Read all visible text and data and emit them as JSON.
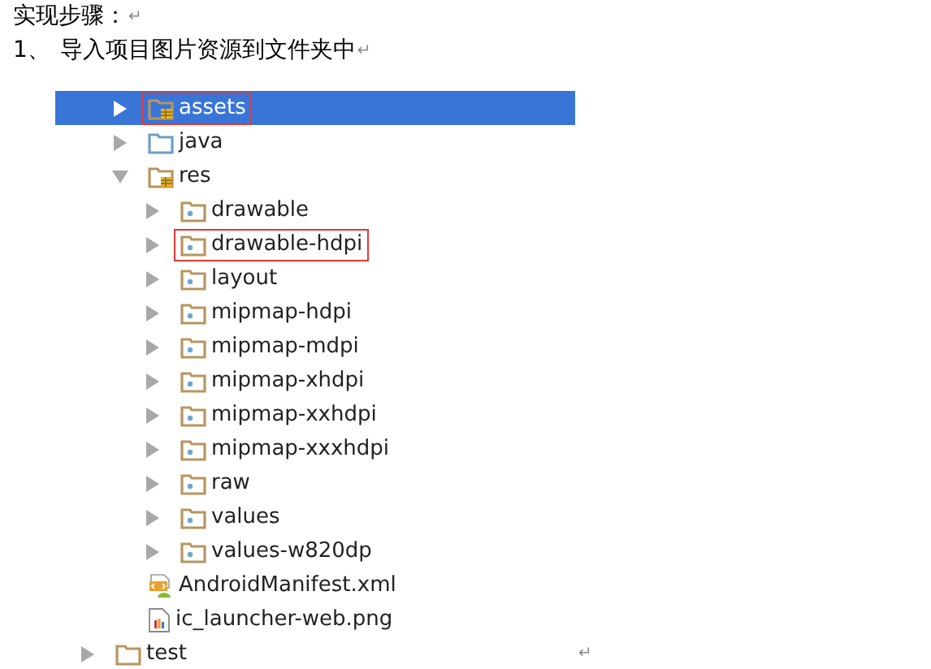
{
  "lines": [
    {
      "text": "实现步骤：",
      "end_mark": "↵"
    },
    {
      "number": "1、",
      "text": "导入项目图片资源到文件夹中",
      "end_mark": "↵"
    }
  ],
  "tree": {
    "items": [
      {
        "label": "assets",
        "kind": "assets-folder",
        "expanded": false,
        "selected": true,
        "marked": true
      },
      {
        "label": "java",
        "kind": "source-folder",
        "expanded": false,
        "selected": false,
        "marked": false
      },
      {
        "label": "res",
        "kind": "res-folder",
        "expanded": true,
        "selected": false,
        "marked": false,
        "children": [
          {
            "label": "drawable",
            "kind": "folder",
            "expanded": false,
            "selected": false,
            "marked": false
          },
          {
            "label": "drawable-hdpi",
            "kind": "folder",
            "expanded": false,
            "selected": false,
            "marked": true
          },
          {
            "label": "layout",
            "kind": "folder",
            "expanded": false,
            "selected": false,
            "marked": false
          },
          {
            "label": "mipmap-hdpi",
            "kind": "folder",
            "expanded": false,
            "selected": false,
            "marked": false
          },
          {
            "label": "mipmap-mdpi",
            "kind": "folder",
            "expanded": false,
            "selected": false,
            "marked": false
          },
          {
            "label": "mipmap-xhdpi",
            "kind": "folder",
            "expanded": false,
            "selected": false,
            "marked": false
          },
          {
            "label": "mipmap-xxhdpi",
            "kind": "folder",
            "expanded": false,
            "selected": false,
            "marked": false
          },
          {
            "label": "mipmap-xxxhdpi",
            "kind": "folder",
            "expanded": false,
            "selected": false,
            "marked": false
          },
          {
            "label": "raw",
            "kind": "folder",
            "expanded": false,
            "selected": false,
            "marked": false
          },
          {
            "label": "values",
            "kind": "folder",
            "expanded": false,
            "selected": false,
            "marked": false
          },
          {
            "label": "values-w820dp",
            "kind": "folder",
            "expanded": false,
            "selected": false,
            "marked": false
          }
        ]
      },
      {
        "label": "AndroidManifest.xml",
        "kind": "manifest",
        "selected": false,
        "marked": false
      },
      {
        "label": "ic_launcher-web.png",
        "kind": "image",
        "selected": false,
        "marked": false
      }
    ],
    "after": [
      {
        "label": "test",
        "kind": "plain-folder",
        "expanded": false,
        "selected": false,
        "marked": false,
        "end_mark": "↵"
      }
    ]
  }
}
